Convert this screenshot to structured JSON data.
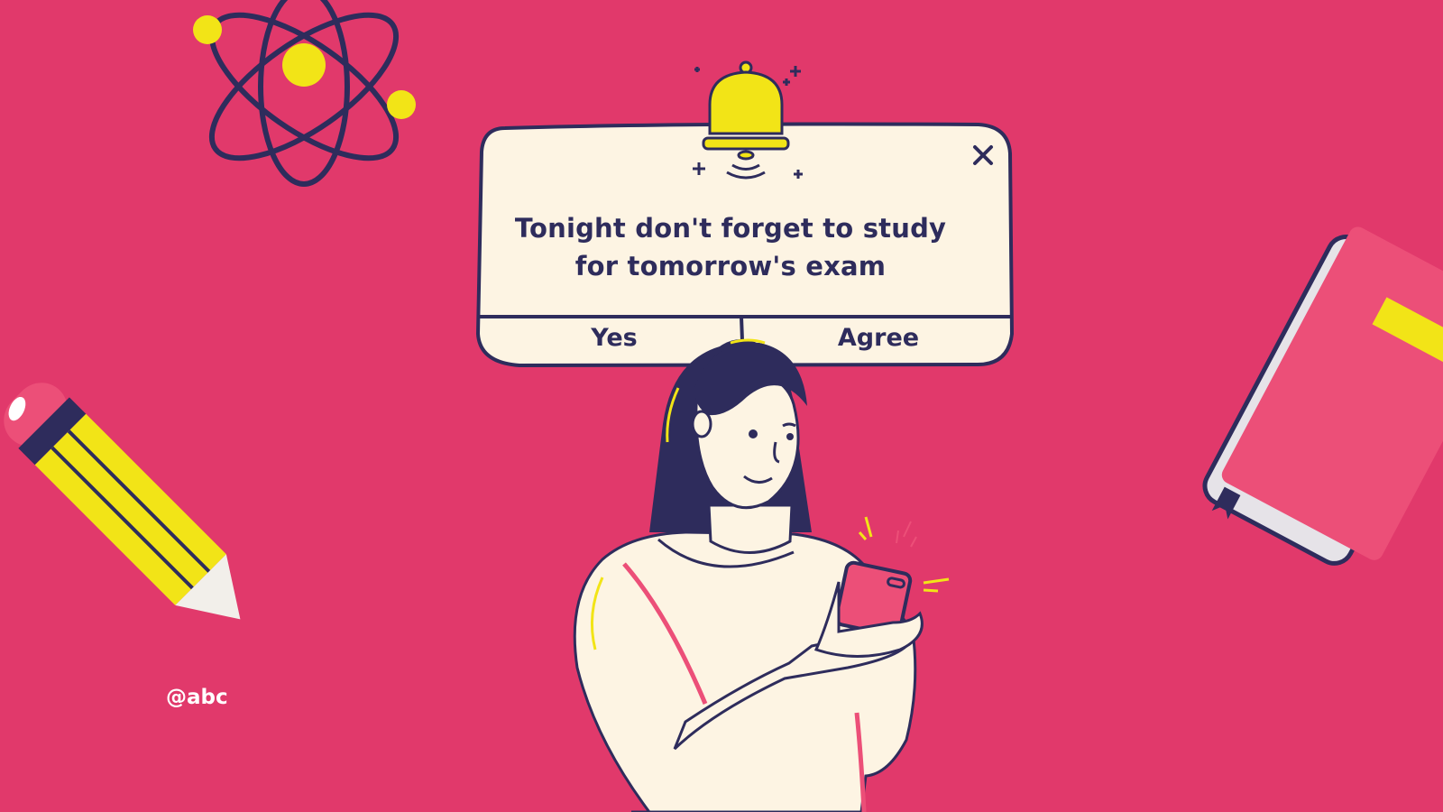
{
  "colors": {
    "background": "#E1396B",
    "dialog_fill": "#FDF4E3",
    "ink": "#2E2C5C",
    "yellow": "#F2E417",
    "pink_accent": "#EC4F78",
    "white": "#FFFFFF"
  },
  "dialog": {
    "message_line_1": "Tonight don't forget to study",
    "message_line_2": "for tomorrow's exam",
    "yes_label": "Yes",
    "agree_label": "Agree",
    "close_icon": "close-icon",
    "bell_icon": "bell-icon"
  },
  "decorations": {
    "atom_icon": "atom-icon",
    "pencil_icon": "pencil-icon",
    "book_icon": "book-icon",
    "person_illustration": "woman-with-phone"
  },
  "footer": {
    "handle": "@abc"
  }
}
